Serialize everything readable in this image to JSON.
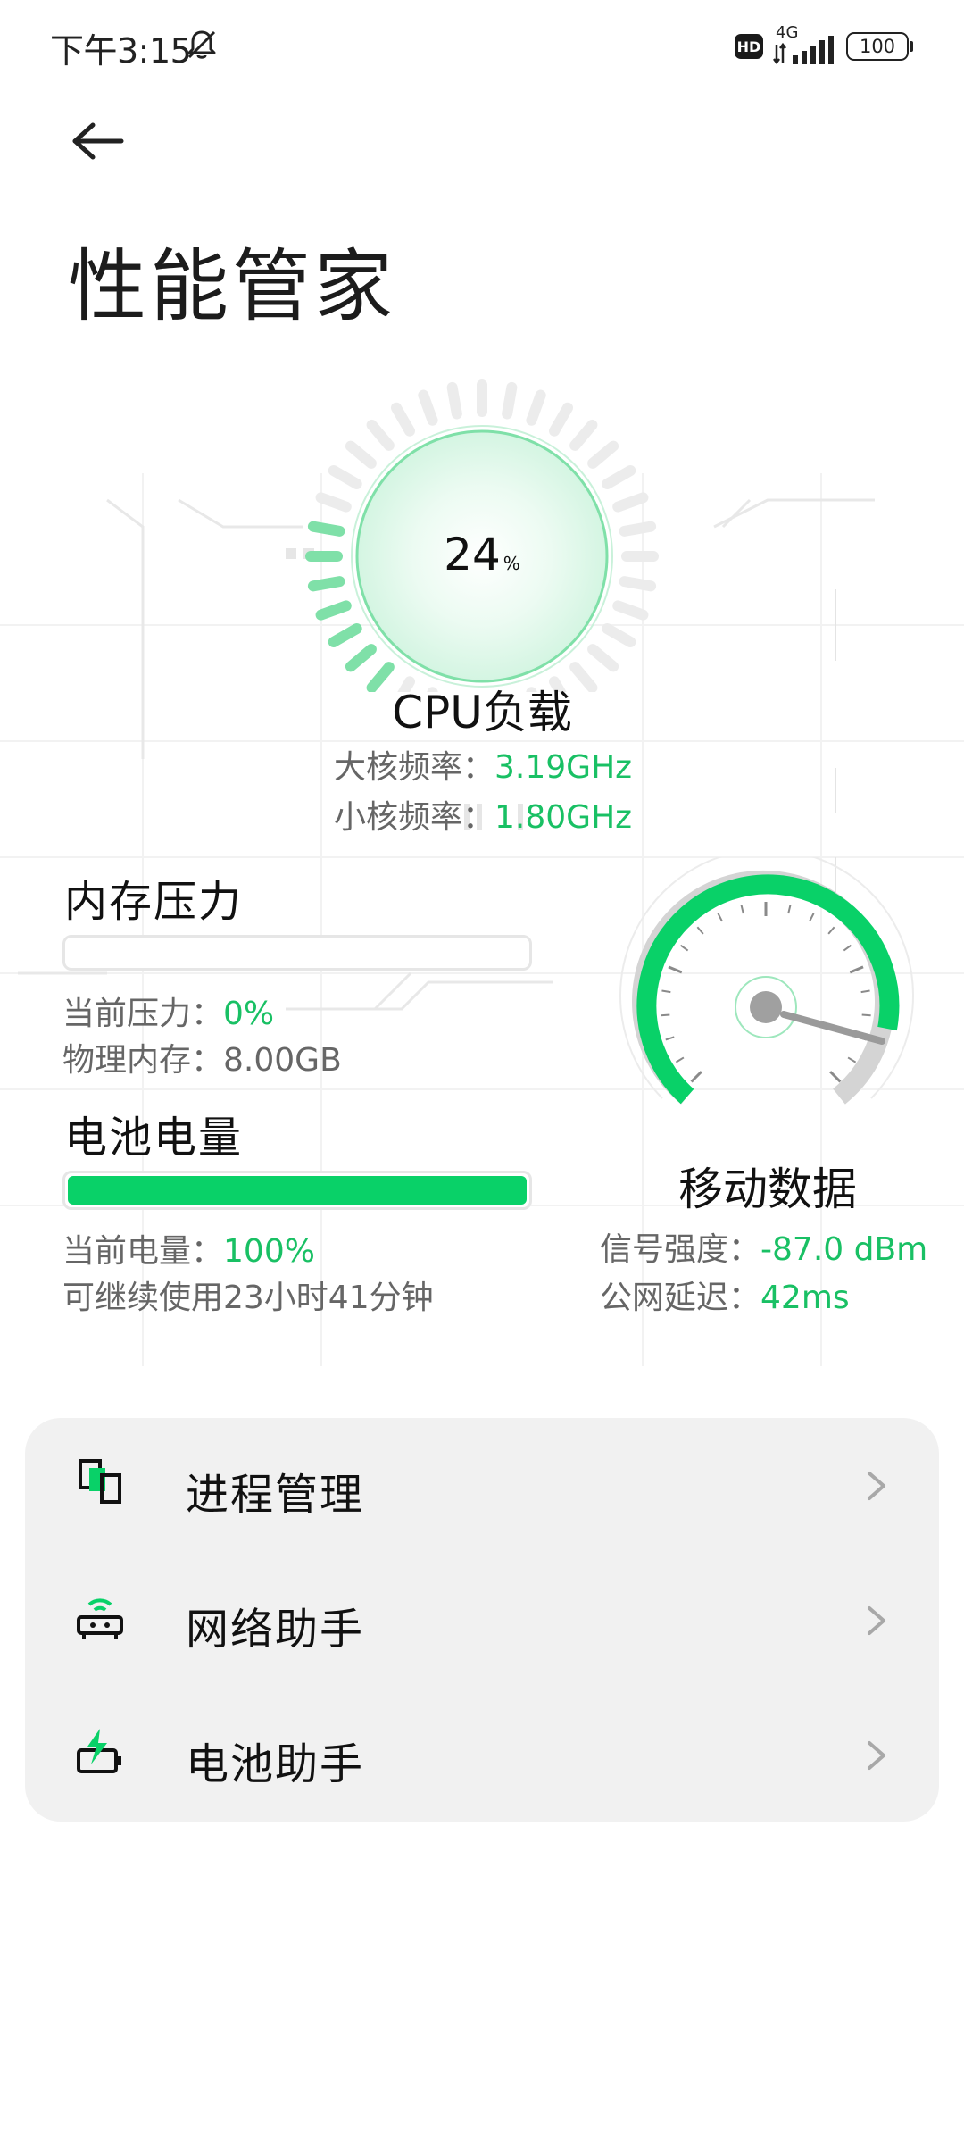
{
  "status_bar": {
    "time": "下午3:15",
    "hd": "HD",
    "network": "4G",
    "battery": "100"
  },
  "header": {
    "title": "性能管家"
  },
  "cpu": {
    "load_value": "24",
    "load_unit": "%",
    "load_fraction": 0.24,
    "title": "CPU负载",
    "big_core_label": "大核频率：",
    "big_core_value": "3.19GHz",
    "small_core_label": "小核频率：",
    "small_core_value": "1.80GHz"
  },
  "memory": {
    "title": "内存压力",
    "pressure_label": "当前压力：",
    "pressure_value": "0%",
    "pressure_fraction": 0.0,
    "physical_label": "物理内存：",
    "physical_value": "8.00GB"
  },
  "battery": {
    "title": "电池电量",
    "level_label": "当前电量：",
    "level_value": "100%",
    "level_fraction": 1.0,
    "remaining": "可继续使用23小时41分钟"
  },
  "mobile_data": {
    "title": "移动数据",
    "signal_label": "信号强度：",
    "signal_value": "-87.0 dBm",
    "latency_label": "公网延迟：",
    "latency_value": "42ms"
  },
  "menu": {
    "items": [
      {
        "label": "进程管理",
        "icon": "process-icon"
      },
      {
        "label": "网络助手",
        "icon": "router-icon"
      },
      {
        "label": "电池助手",
        "icon": "battery-charge-icon"
      }
    ]
  },
  "colors": {
    "accent": "#09d168",
    "text_value": "#19c064",
    "card_bg": "#f1f1f1"
  }
}
